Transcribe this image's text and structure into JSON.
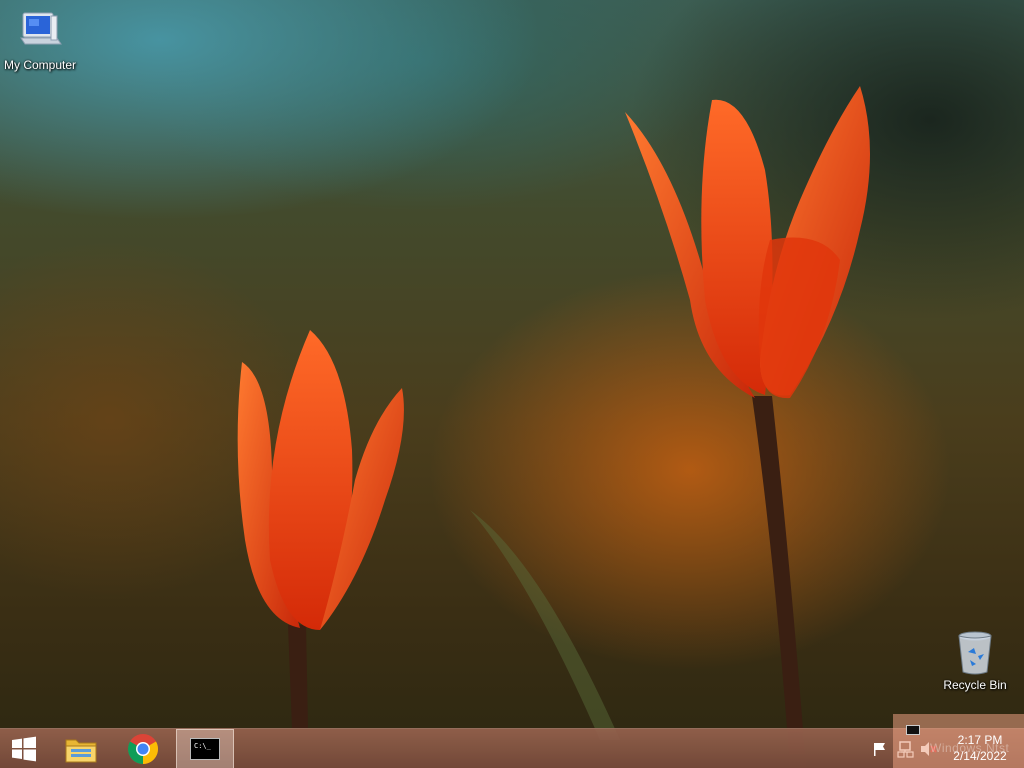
{
  "desktop": {
    "icons": [
      {
        "label": "My Computer",
        "icon": "computer-icon"
      },
      {
        "label": "Recycle Bin",
        "icon": "recycle-bin-icon"
      }
    ]
  },
  "taskbar": {
    "start": {
      "icon": "windows-logo-icon"
    },
    "apps": [
      {
        "icon": "file-explorer-icon",
        "active": false
      },
      {
        "icon": "chrome-icon",
        "active": false
      },
      {
        "icon": "command-prompt-icon",
        "active": true,
        "glyph": "C:\\_"
      }
    ],
    "tray": {
      "icons": [
        "action-center-flag-icon",
        "network-icon",
        "volume-muted-icon"
      ]
    },
    "clock": {
      "time": "2:17 PM",
      "date": "2/14/2022"
    }
  },
  "notification": {
    "watermark": "Windows Ntst"
  },
  "colors": {
    "taskbar": "#8e5c48",
    "tulip": "#ff4a14",
    "stem": "#3a1f12"
  }
}
